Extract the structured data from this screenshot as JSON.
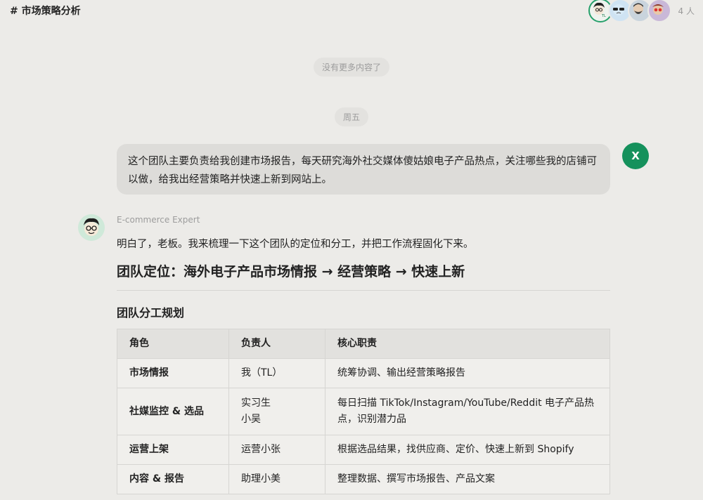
{
  "header": {
    "channel_title": "# 市场策略分析",
    "member_count": "4 人",
    "avatars": [
      "avatar-tl-icon",
      "avatar-sunglasses-icon",
      "avatar-beard-icon",
      "avatar-red-glasses-icon"
    ]
  },
  "chat": {
    "no_more": "没有更多内容了",
    "day_divider": "周五",
    "user_message": {
      "avatar_letter": "X",
      "text": "这个团队主要负责给我创建市场报告，每天研究海外社交媒体傻姑娘电子产品热点，关注哪些我的店铺可以做，给我出经营策略并快速上新到网站上。"
    },
    "bot_message": {
      "sender": "E-commerce Expert",
      "intro": "明白了，老板。我来梳理一下这个团队的定位和分工，并把工作流程固化下来。",
      "heading": "团队定位：海外电子产品市场情报 → 经营策略 → 快速上新",
      "subheading": "团队分工规划",
      "table": {
        "headers": [
          "角色",
          "负责人",
          "核心职责"
        ],
        "rows": [
          [
            "市场情报",
            "我（TL）",
            "统筹协调、输出经营策略报告"
          ],
          [
            "社媒监控 & 选品",
            "实习生\n小吴",
            "每日扫描 TikTok/Instagram/YouTube/Reddit 电子产品热点，识别潜力品"
          ],
          [
            "运营上架",
            "运营小张",
            "根据选品结果，找供应商、定价、快速上新到 Shopify"
          ],
          [
            "内容 & 报告",
            "助理小美",
            "整理数据、撰写市场报告、产品文案"
          ]
        ]
      }
    }
  },
  "colors": {
    "background": "#ecebe8",
    "user_avatar": "#15915c",
    "bubble": "#dddcd9"
  }
}
